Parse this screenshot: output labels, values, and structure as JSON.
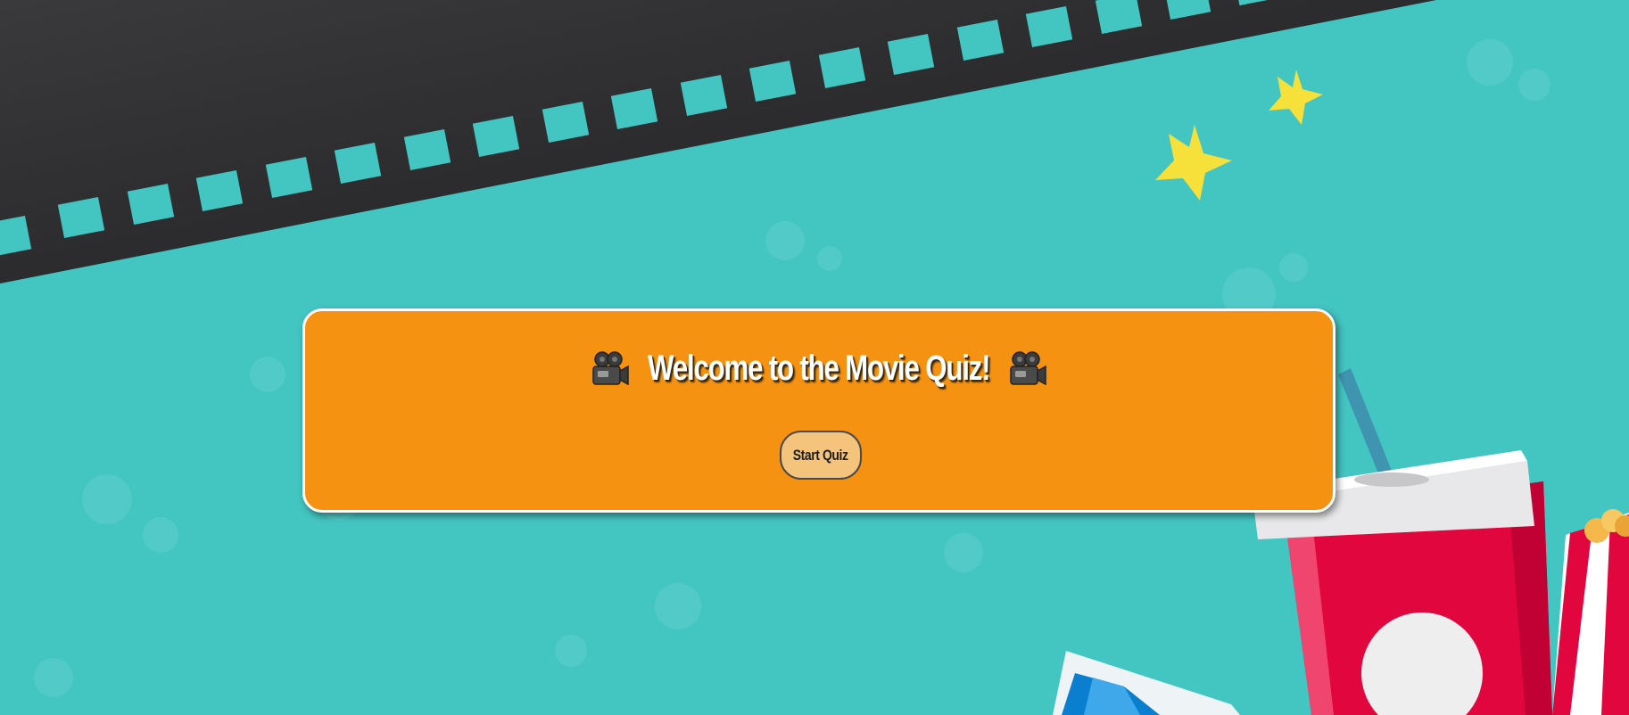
{
  "quiz": {
    "title": "Welcome to the Movie Quiz!",
    "start_label": "Start Quiz"
  },
  "colors": {
    "background": "#43c5c2",
    "card": "#f59211",
    "card_border": "#ffffff",
    "button": "#f4c47c",
    "film_strip": "#2b2b2d",
    "star": "#f6e03a",
    "cup_red": "#e2063e"
  },
  "icons": {
    "title_left": "movie-camera-icon",
    "title_right": "movie-camera-icon"
  }
}
